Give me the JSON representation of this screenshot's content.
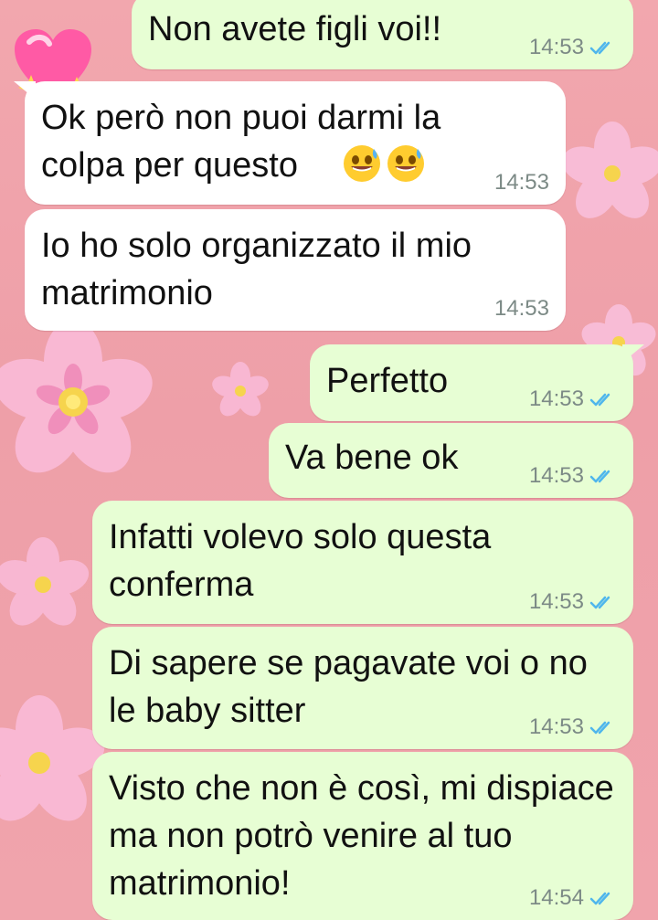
{
  "conversation": {
    "messages": [
      {
        "direction": "outgoing",
        "text": "Non avete figli voi!!",
        "time": "14:53",
        "status_icon": "double-check-icon"
      },
      {
        "direction": "incoming",
        "text": "Ok però non puoi darmi la colpa per questo",
        "time": "14:53",
        "emoji": "😅😅"
      },
      {
        "direction": "incoming",
        "text": "Io ho solo organizzato il mio matrimonio",
        "time": "14:53"
      },
      {
        "direction": "outgoing",
        "text": "Perfetto",
        "time": "14:53",
        "status_icon": "double-check-icon"
      },
      {
        "direction": "outgoing",
        "text": "Va bene ok",
        "time": "14:53",
        "status_icon": "double-check-icon"
      },
      {
        "direction": "outgoing",
        "text": "Infatti volevo solo questa conferma",
        "time": "14:53",
        "status_icon": "double-check-icon"
      },
      {
        "direction": "outgoing",
        "text": "Di sapere se pagavate voi o no le baby sitter",
        "time": "14:53",
        "status_icon": "double-check-icon"
      },
      {
        "direction": "outgoing",
        "text": "Visto che non è così, mi dispiace ma non potrò venire al tuo matrimonio!",
        "time": "14:54",
        "status_icon": "double-check-icon"
      }
    ]
  },
  "theme": {
    "wallpaper": "#f0a3ab",
    "incoming_bubble": "#ffffff",
    "outgoing_bubble": "#e7fed4",
    "timestamp": "#7c8a86",
    "read_receipt": "#4fb6ec"
  }
}
